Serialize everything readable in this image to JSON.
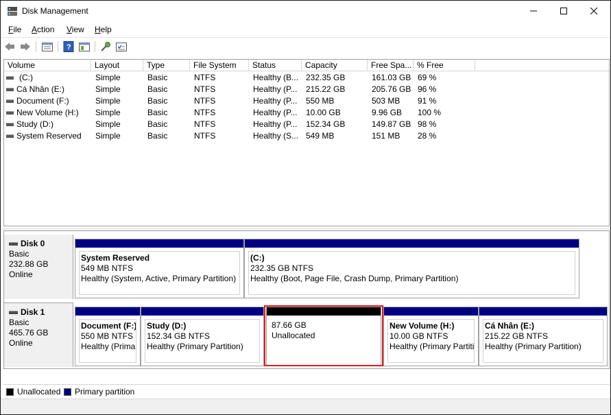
{
  "window": {
    "title": "Disk Management"
  },
  "menu": [
    {
      "accel": "F",
      "rest": "ile"
    },
    {
      "accel": "A",
      "rest": "ction"
    },
    {
      "accel": "V",
      "rest": "iew"
    },
    {
      "accel": "H",
      "rest": "elp"
    }
  ],
  "volume_list": {
    "columns": [
      "Volume",
      "Layout",
      "Type",
      "File System",
      "Status",
      "Capacity",
      "Free Spa...",
      "% Free"
    ],
    "rows": [
      [
        "(C:)",
        "Simple",
        "Basic",
        "NTFS",
        "Healthy (B...",
        "232.35 GB",
        "161.03 GB",
        "69 %"
      ],
      [
        "Cá Nhân (E:)",
        "Simple",
        "Basic",
        "NTFS",
        "Healthy (P...",
        "215.22 GB",
        "205.76 GB",
        "96 %"
      ],
      [
        "Document (F:)",
        "Simple",
        "Basic",
        "NTFS",
        "Healthy (P...",
        "550 MB",
        "503 MB",
        "91 %"
      ],
      [
        "New Volume (H:)",
        "Simple",
        "Basic",
        "NTFS",
        "Healthy (P...",
        "10.00 GB",
        "9.96 GB",
        "100 %"
      ],
      [
        "Study (D:)",
        "Simple",
        "Basic",
        "NTFS",
        "Healthy (P...",
        "152.34 GB",
        "149.87 GB",
        "98 %"
      ],
      [
        "System Reserved",
        "Simple",
        "Basic",
        "NTFS",
        "Healthy (S...",
        "549 MB",
        "151 MB",
        "28 %"
      ]
    ]
  },
  "disks": [
    {
      "name": "Disk 0",
      "type": "Basic",
      "size": "232.88 GB",
      "state": "Online",
      "partitions": [
        {
          "name": "System Reserved",
          "size": "549 MB NTFS",
          "status": "Healthy (System, Active, Primary Partition)"
        },
        {
          "name": "(C:)",
          "size": "232.35 GB NTFS",
          "status": "Healthy (Boot, Page File, Crash Dump, Primary Partition)"
        }
      ]
    },
    {
      "name": "Disk 1",
      "type": "Basic",
      "size": "465.76 GB",
      "state": "Online",
      "partitions": [
        {
          "name": "Document  (F:)",
          "size": "550 MB NTFS",
          "status": "Healthy (Prima"
        },
        {
          "name": "Study  (D:)",
          "size": "152.34 GB NTFS",
          "status": "Healthy (Primary Partition)"
        },
        {
          "name": "",
          "size": "87.66 GB",
          "status": "Unallocated"
        },
        {
          "name": "New Volume  (H:)",
          "size": "10.00 GB NTFS",
          "status": "Healthy (Primary Partiti"
        },
        {
          "name": "Cá Nhân  (E:)",
          "size": "215.22 GB NTFS",
          "status": "Healthy (Primary Partition)"
        }
      ]
    }
  ],
  "legend": [
    {
      "label": "Unallocated",
      "color": "#000000"
    },
    {
      "label": "Primary partition",
      "color": "#000080"
    }
  ],
  "colors": {
    "primary": "#000080",
    "unallocated": "#000000",
    "selection": "#e11b22"
  }
}
